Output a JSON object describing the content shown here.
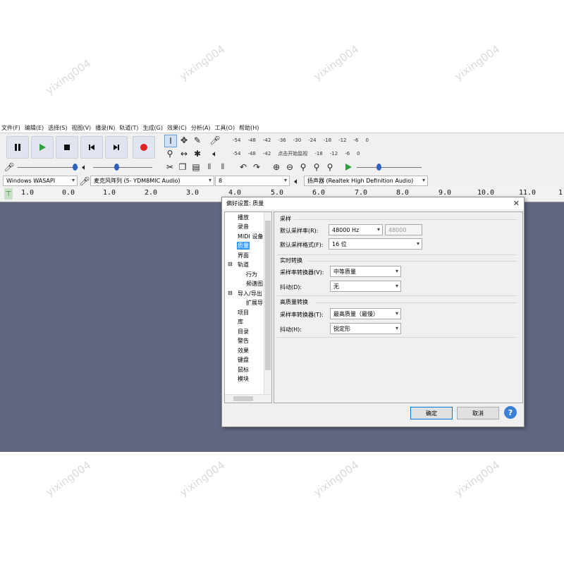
{
  "menu": [
    "文件(F)",
    "编辑(E)",
    "选择(S)",
    "视图(V)",
    "播录(N)",
    "轨道(T)",
    "生成(G)",
    "效果(C)",
    "分析(A)",
    "工具(O)",
    "帮助(H)"
  ],
  "meters": {
    "record_ticks": [
      "-54",
      "-48",
      "-42",
      "-36",
      "-30",
      "-24",
      "-18",
      "-12",
      "-6",
      "0"
    ],
    "play_ticks_left": [
      "-54",
      "-48",
      "-42"
    ],
    "play_hint": "点击开始监视",
    "play_ticks_right": [
      "-18",
      "-12",
      "-6",
      "0"
    ]
  },
  "devices": {
    "host": "Windows WASAPI",
    "mic": "麦克风阵列 (5- YDM8MIC Audio)",
    "channels": "8",
    "speaker": "扬声器 (Realtek High Definition Audio)"
  },
  "ruler": {
    "ticks": [
      "1.0",
      "0.0",
      "1.0",
      "2.0",
      "3.0",
      "4.0",
      "5.0",
      "6.0",
      "7.0",
      "8.0",
      "9.0",
      "10.0",
      "11.0",
      "1"
    ]
  },
  "dialog": {
    "title": "偏好设置: 质量",
    "close": "✕",
    "tree": [
      "播放",
      "录音",
      "MIDI 设备",
      "质量",
      "界面",
      "轨道",
      "行为",
      "频谱图",
      "导入/导出",
      "扩展导",
      "项目",
      "库",
      "目录",
      "警告",
      "效果",
      "键盘",
      "鼠标",
      "模块"
    ],
    "selected_tree_item": "质量",
    "sampling": {
      "title": "采样",
      "rate_label": "默认采样率(R):",
      "rate_value": "48000 Hz",
      "rate_custom": "48000",
      "format_label": "默认采样格式(F):",
      "format_value": "16 位"
    },
    "realtime": {
      "title": "实时转换",
      "converter_label": "采样率转换器(V):",
      "converter_value": "中等质量",
      "dither_label": "抖动(D):",
      "dither_value": "无"
    },
    "hq": {
      "title": "高质量转换",
      "converter_label": "采样率转换器(T):",
      "converter_value": "最高质量（最慢）",
      "dither_label": "抖动(H):",
      "dither_value": "锐定形"
    },
    "ok": "确定",
    "cancel": "取消",
    "help": "?"
  },
  "watermark": "yixing004",
  "colors": {
    "track_bg": "#616782",
    "accent_blue": "#3399ff",
    "play_green": "#2e9e3e",
    "record_red": "#e02020",
    "transport_bg": "#dfe4ee"
  },
  "icons": [
    "pause-icon",
    "play-icon",
    "stop-icon",
    "skip-start-icon",
    "skip-end-icon",
    "record-icon",
    "microphone-icon",
    "speaker-icon",
    "select-tool-icon",
    "envelope-tool-icon",
    "draw-tool-icon",
    "zoom-tool-icon",
    "timeshift-tool-icon",
    "multi-tool-icon",
    "cut-icon",
    "copy-icon",
    "paste-icon",
    "trim-icon",
    "silence-icon",
    "undo-icon",
    "redo-icon",
    "zoom-in-icon",
    "zoom-out-icon",
    "fit-selection-icon",
    "fit-project-icon",
    "zoom-toggle-icon",
    "play-at-speed-icon",
    "help-icon"
  ]
}
